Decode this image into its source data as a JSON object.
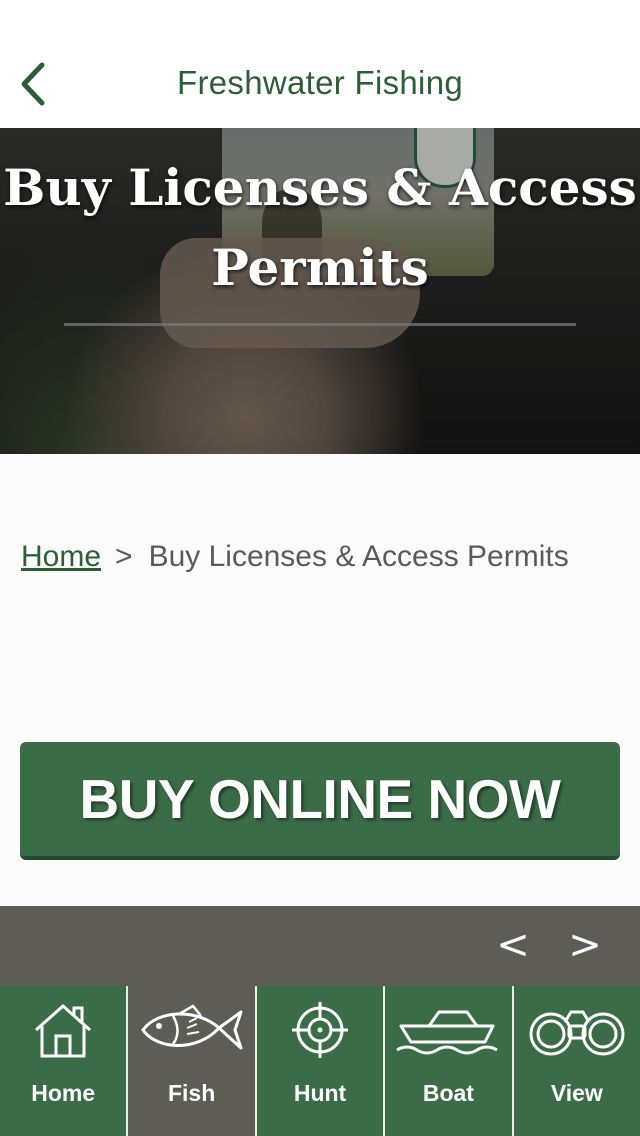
{
  "nav": {
    "title": "Freshwater Fishing",
    "back_icon": "chevron-left-icon"
  },
  "hero": {
    "title_line1": "Buy Licenses & Access",
    "title_line2": "Permits"
  },
  "breadcrumb": {
    "home": "Home",
    "separator": ">",
    "current": "Buy Licenses & Access Permits"
  },
  "cta": {
    "label": "BUY ONLINE NOW"
  },
  "pager": {
    "prev": "<",
    "next": ">"
  },
  "tabs": [
    {
      "label": "Home",
      "icon": "house-icon",
      "active": false
    },
    {
      "label": "Fish",
      "icon": "fish-icon",
      "active": true
    },
    {
      "label": "Hunt",
      "icon": "crosshair-icon",
      "active": false
    },
    {
      "label": "Boat",
      "icon": "boat-icon",
      "active": false
    },
    {
      "label": "View",
      "icon": "binoculars-icon",
      "active": false
    }
  ],
  "colors": {
    "brand_green": "#3a6d47",
    "title_green": "#2d5f37",
    "active_tab_gray": "#5d5c55"
  }
}
